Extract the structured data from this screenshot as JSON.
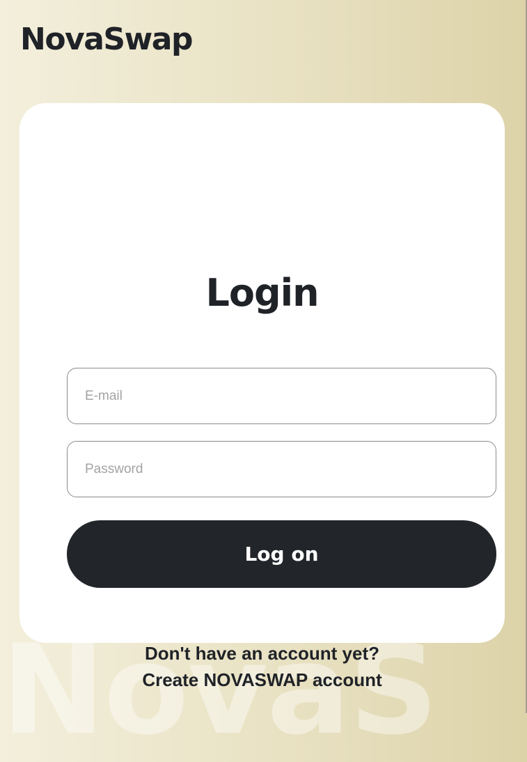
{
  "brand": {
    "name": "NovaSwap",
    "watermark": "NovaS"
  },
  "login": {
    "title": "Login",
    "email_placeholder": "E-mail",
    "email_value": "",
    "password_placeholder": "Password",
    "password_value": "",
    "submit_label": "Log on",
    "no_account_text": "Don't have an account yet?",
    "create_account_label": "Create NOVASWAP account"
  },
  "colors": {
    "background_light": "#f3efdc",
    "background_dark": "#ddd3a9",
    "card": "#ffffff",
    "text": "#1f2227",
    "button": "#22252a"
  }
}
